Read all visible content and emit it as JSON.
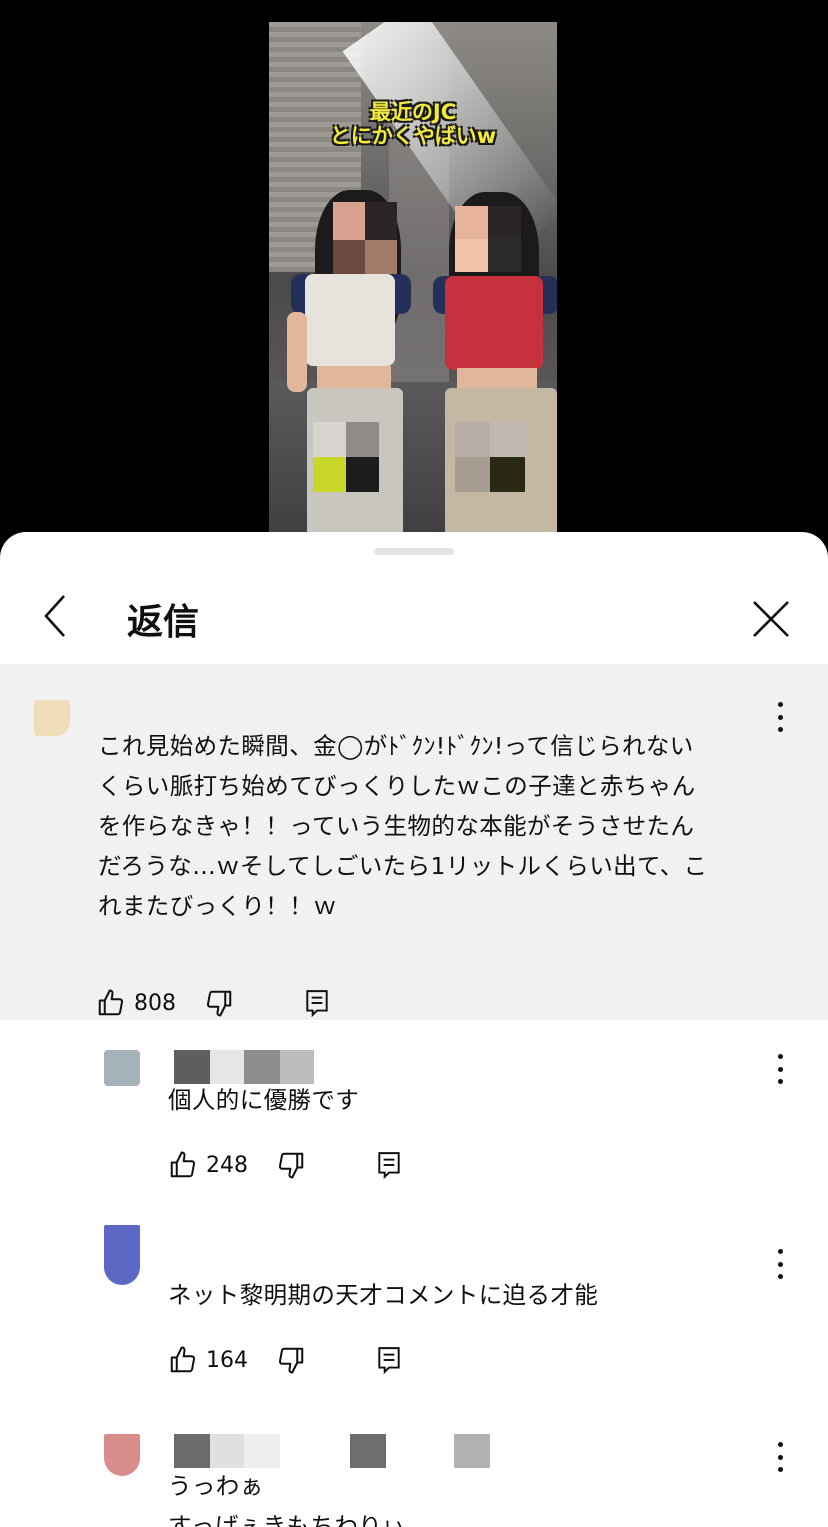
{
  "video": {
    "caption_line1": "最近のJC",
    "caption_line2": "とにかくやばいw"
  },
  "header": {
    "title": "返信"
  },
  "parent_comment": {
    "avatar_color": "#efdcb8",
    "lines": [
      "これ見始めた瞬間、金◯がﾄﾞｸﾝ!ﾄﾞｸﾝ!って信じられない",
      "くらい脈打ち始めてびっくりしたｗこの子達と赤ちゃん",
      "を作らなきゃ！！っていう生物的な本能がそうさせたん",
      "だろうな…ｗそしてしごいたら1リットルくらい出て、こ",
      "れまたびっくり！！ｗ"
    ],
    "likes": "808"
  },
  "replies": [
    {
      "avatar_color": "#a6b2b9",
      "text": "個人的に優勝です",
      "likes": "248"
    },
    {
      "avatar_color": "#5c68c4",
      "text": "ネット黎明期の天才コメントに迫る才能",
      "likes": "164"
    },
    {
      "avatar_color": "#d98c8c",
      "text_line1": "うっわぁ",
      "text_line2": "すっげぇきもちわりぃ"
    }
  ]
}
